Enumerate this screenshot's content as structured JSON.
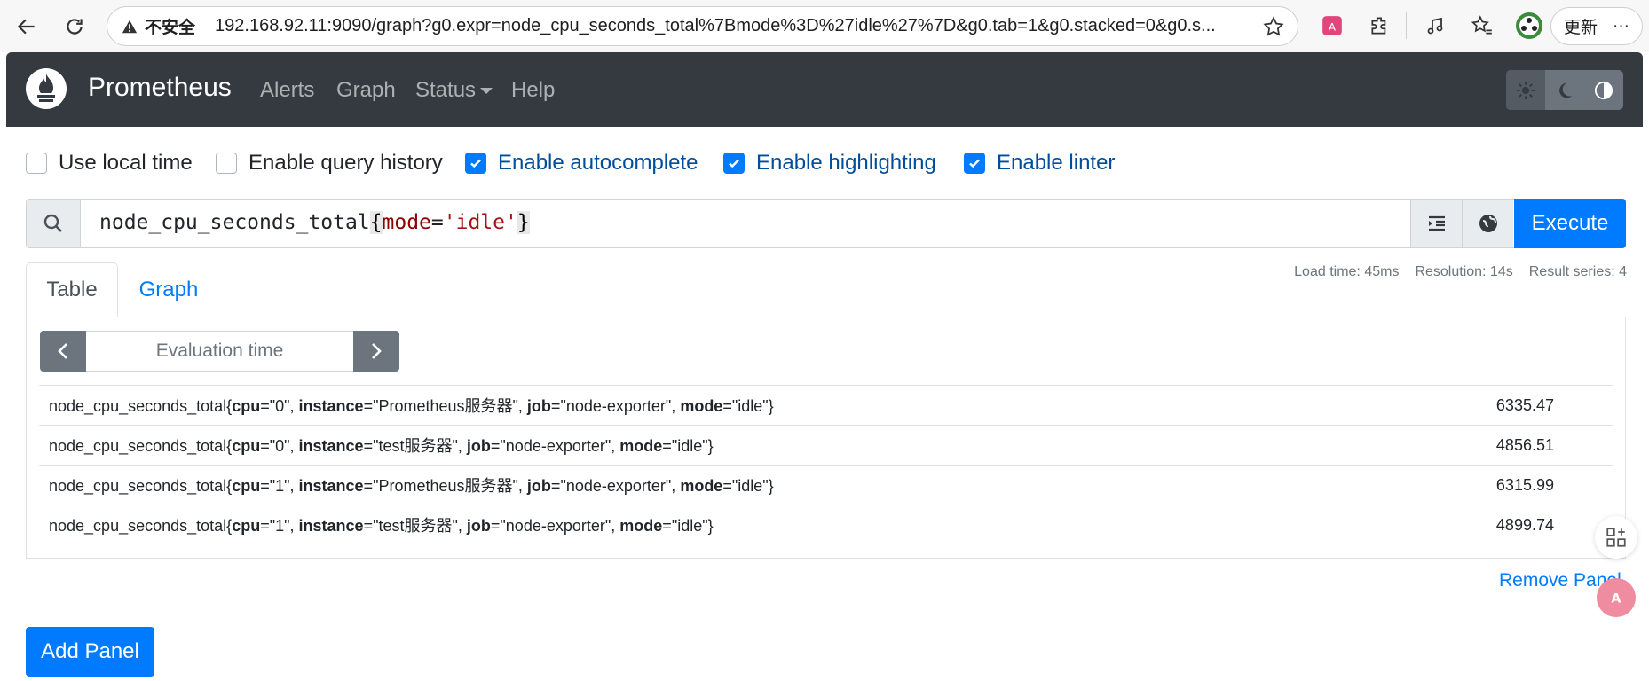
{
  "browser": {
    "security_label": "不安全",
    "url": "192.168.92.11:9090/graph?g0.expr=node_cpu_seconds_total%7Bmode%3D%27idle%27%7D&g0.tab=1&g0.stacked=0&g0.s...",
    "update_label": "更新",
    "more_label": "···"
  },
  "navbar": {
    "brand": "Prometheus",
    "links": [
      "Alerts",
      "Graph",
      "Status",
      "Help"
    ]
  },
  "options": [
    {
      "label": "Use local time",
      "checked": false
    },
    {
      "label": "Enable query history",
      "checked": false
    },
    {
      "label": "Enable autocomplete",
      "checked": true
    },
    {
      "label": "Enable highlighting",
      "checked": true
    },
    {
      "label": "Enable linter",
      "checked": true
    }
  ],
  "expression": {
    "metric": "node_cpu_seconds_total",
    "open_brace": "{",
    "label_name": "mode",
    "operator": "=",
    "label_value": "'idle'",
    "close_brace": "}"
  },
  "execute_label": "Execute",
  "tabs": {
    "table": "Table",
    "graph": "Graph"
  },
  "stats": {
    "load_time": "Load time: 45ms",
    "resolution": "Resolution: 14s",
    "result_series": "Result series: 4"
  },
  "evaluation_time_placeholder": "Evaluation time",
  "results": [
    {
      "metric": "node_cpu_seconds_total",
      "cpu": "\"0\"",
      "instance": "\"Prometheus服务器\"",
      "job": "\"node-exporter\"",
      "mode": "\"idle\"",
      "value": "6335.47"
    },
    {
      "metric": "node_cpu_seconds_total",
      "cpu": "\"0\"",
      "instance": "\"test服务器\"",
      "job": "\"node-exporter\"",
      "mode": "\"idle\"",
      "value": "4856.51"
    },
    {
      "metric": "node_cpu_seconds_total",
      "cpu": "\"1\"",
      "instance": "\"Prometheus服务器\"",
      "job": "\"node-exporter\"",
      "mode": "\"idle\"",
      "value": "6315.99"
    },
    {
      "metric": "node_cpu_seconds_total",
      "cpu": "\"1\"",
      "instance": "\"test服务器\"",
      "job": "\"node-exporter\"",
      "mode": "\"idle\"",
      "value": "4899.74"
    }
  ],
  "label_keys": {
    "cpu": "cpu",
    "instance": "instance",
    "job": "job",
    "mode": "mode"
  },
  "remove_panel_label": "Remove Panel",
  "add_panel_label": "Add Panel",
  "colors": {
    "primary": "#007bff",
    "navbar": "#343a40",
    "secondary": "#6c757d"
  }
}
